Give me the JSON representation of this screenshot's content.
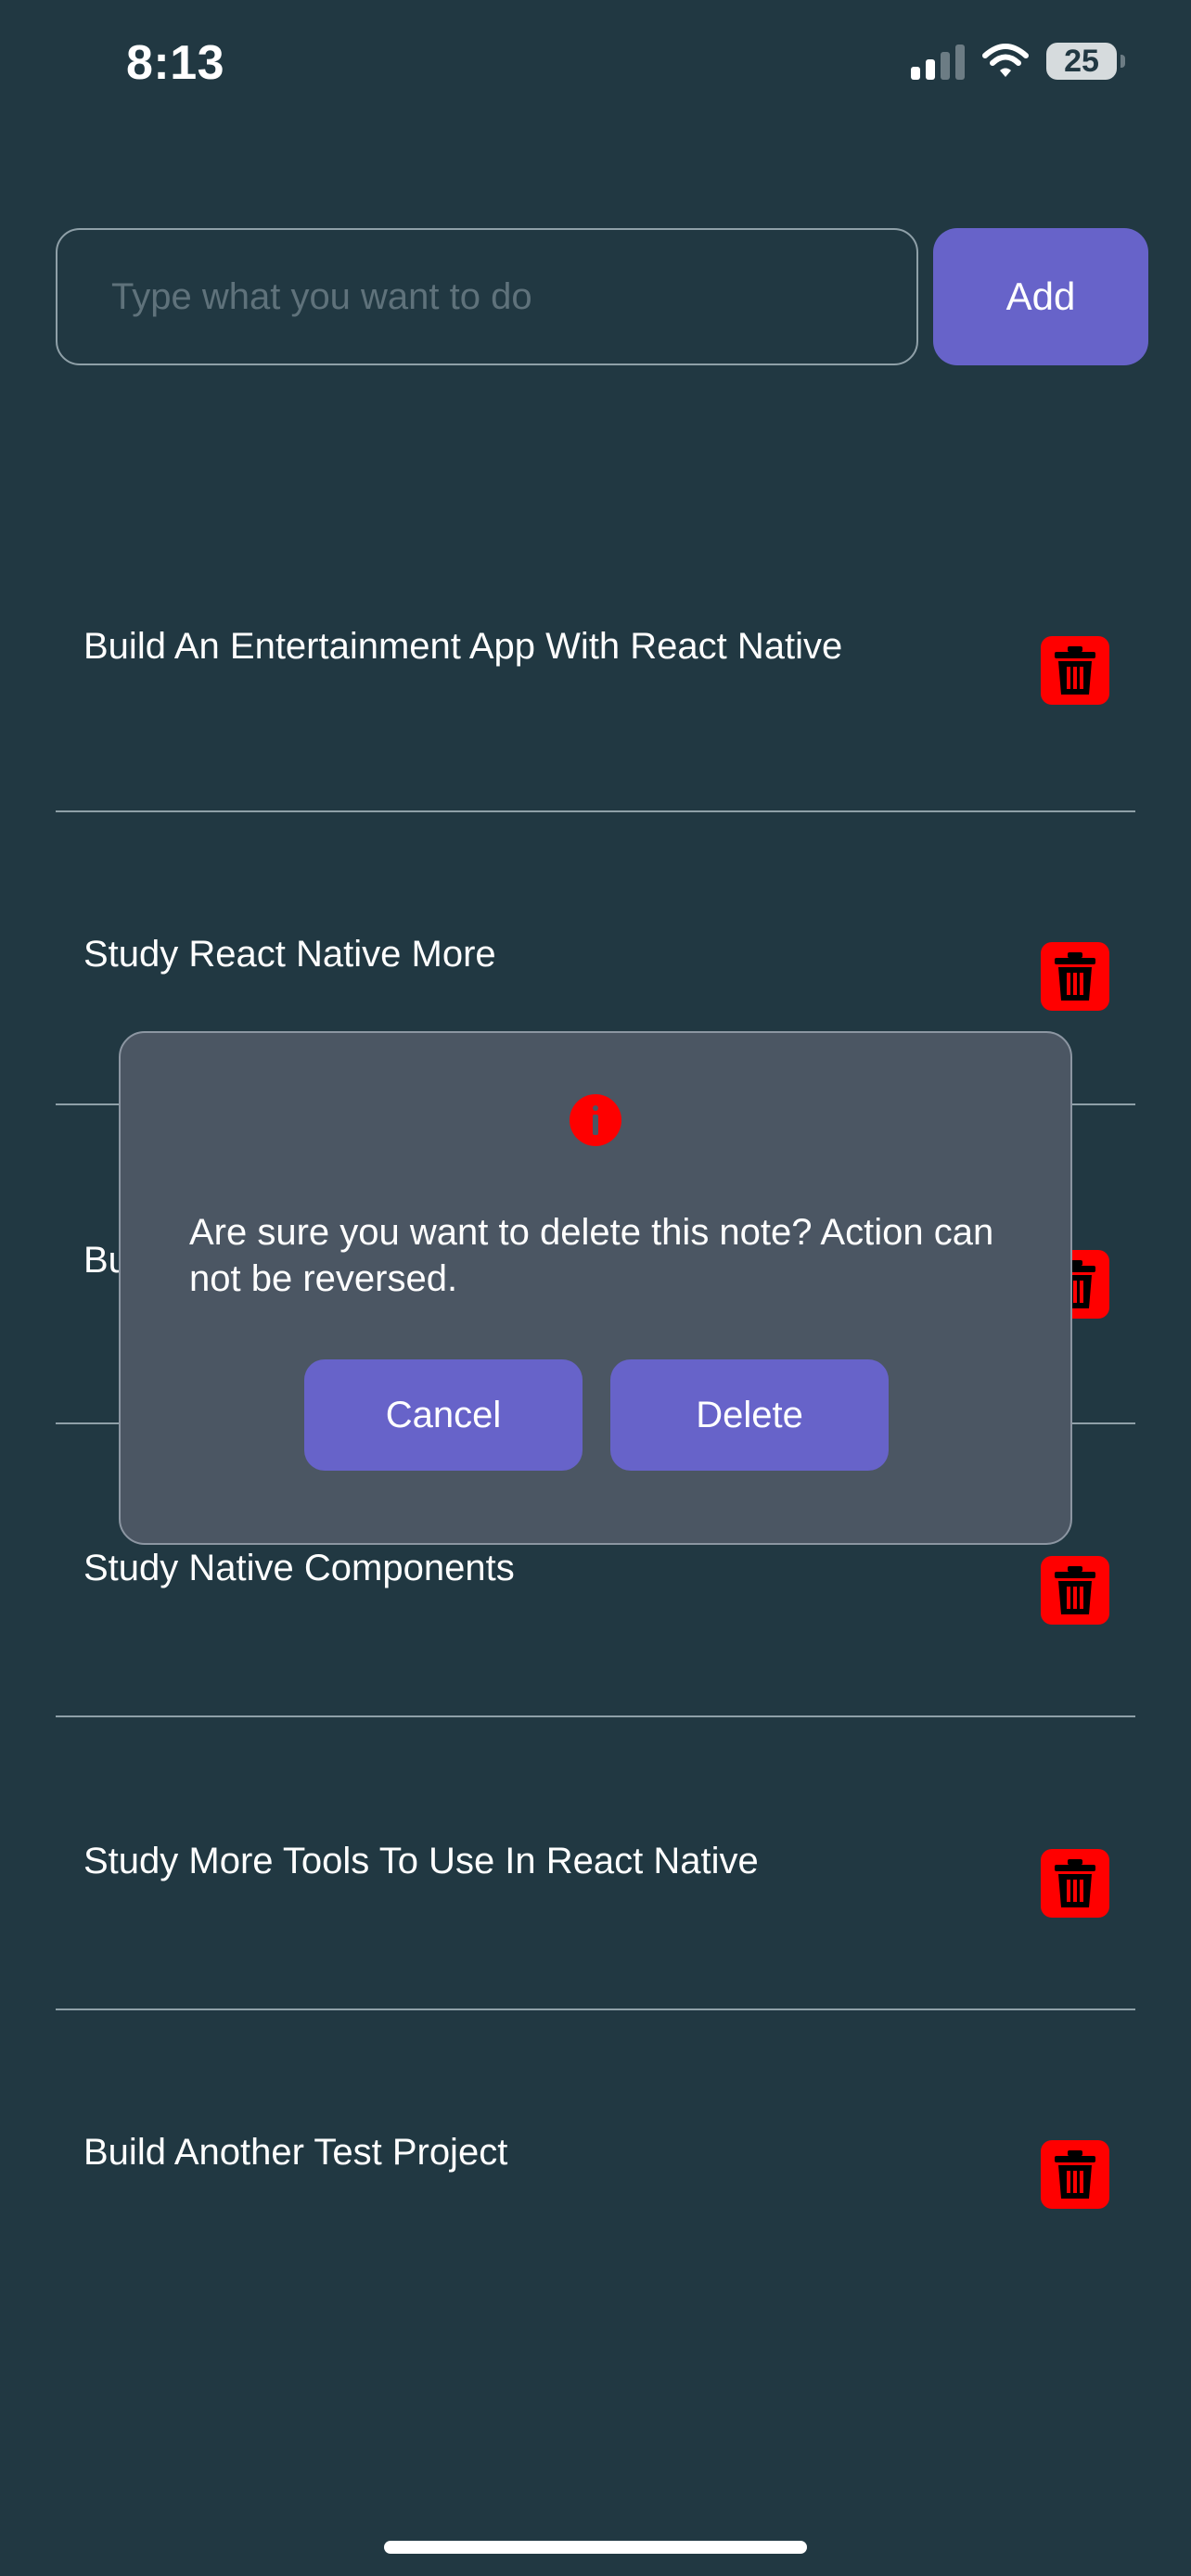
{
  "status_bar": {
    "time": "8:13",
    "battery": "25"
  },
  "input": {
    "placeholder": "Type what you want to do",
    "value": ""
  },
  "add_button": {
    "label": "Add"
  },
  "todos": [
    {
      "text": "Build An Entertainment App With React Native"
    },
    {
      "text": "Study React Native More"
    },
    {
      "text": "Bu"
    },
    {
      "text": "Study Native Components"
    },
    {
      "text": "Study More Tools To Use In React Native"
    },
    {
      "text": "Build Another Test Project"
    }
  ],
  "modal": {
    "message": "Are sure you want to delete this note? Action can not be reversed.",
    "cancel_label": "Cancel",
    "delete_label": "Delete"
  },
  "colors": {
    "background": "#213842",
    "accent": "#6763c9",
    "danger": "#ff0000",
    "modal": "#4b5663"
  }
}
